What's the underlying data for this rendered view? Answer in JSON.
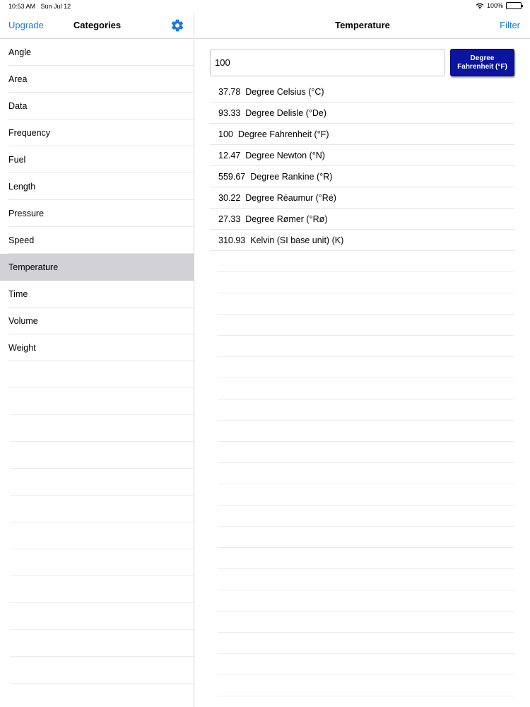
{
  "status": {
    "time": "10:53 AM",
    "date": "Sun Jul 12",
    "battery": "100%",
    "wifi_icon": "wifi-icon",
    "battery_icon": "battery-icon"
  },
  "sidebar": {
    "upgrade_label": "Upgrade",
    "title": "Categories",
    "settings_icon": "gear-icon",
    "items": [
      {
        "label": "Angle"
      },
      {
        "label": "Area"
      },
      {
        "label": "Data"
      },
      {
        "label": "Frequency"
      },
      {
        "label": "Fuel"
      },
      {
        "label": "Length"
      },
      {
        "label": "Pressure"
      },
      {
        "label": "Speed"
      },
      {
        "label": "Temperature",
        "selected": true
      },
      {
        "label": "Time"
      },
      {
        "label": "Volume"
      },
      {
        "label": "Weight"
      }
    ]
  },
  "main": {
    "title": "Temperature",
    "filter_label": "Filter",
    "input_value": "100",
    "unit_button_label": "Degree Fahrenheit (°F)",
    "results": [
      {
        "value": "37.78",
        "unit": "Degree Celsius (°C)"
      },
      {
        "value": "93.33",
        "unit": "Degree Delisle (°De)"
      },
      {
        "value": "100",
        "unit": "Degree Fahrenheit (°F)"
      },
      {
        "value": "12.47",
        "unit": "Degree Newton (°N)"
      },
      {
        "value": "559.67",
        "unit": "Degree Rankine (°R)"
      },
      {
        "value": "30.22",
        "unit": "Degree Réaumur (°Ré)"
      },
      {
        "value": "27.33",
        "unit": "Degree Rømer (°Rø)"
      },
      {
        "value": "310.93",
        "unit": "Kelvin (SI base unit) (K)"
      }
    ]
  },
  "colors": {
    "accent": "#1a7be0",
    "unit_button_bg": "#0a14a0",
    "selected_row": "#d1d1d6"
  }
}
